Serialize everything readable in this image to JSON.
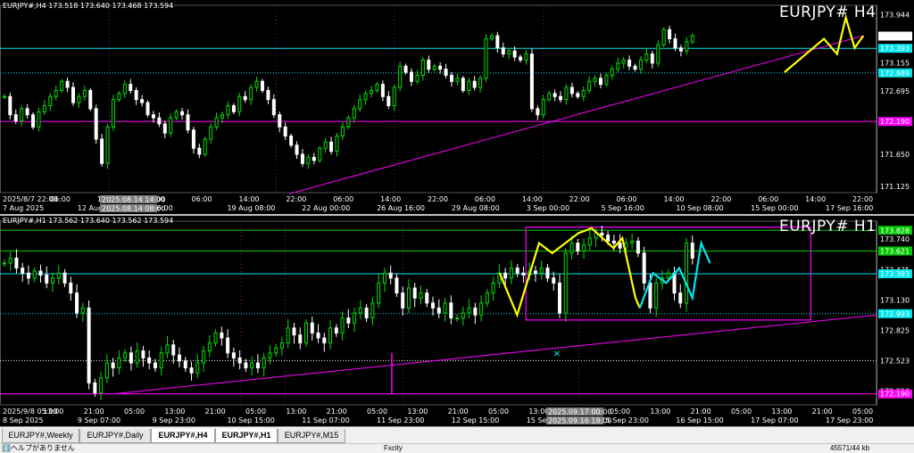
{
  "colors": {
    "bull": "#00e000",
    "bear": "#ffffff",
    "cyan": "#00e5ee",
    "magenta": "#ff00ff",
    "yellow": "#ffff00",
    "grid": "#2a2a2a",
    "axis": "#ffffff"
  },
  "tabs": [
    {
      "label": "EURJPY#,Weekly",
      "active": false
    },
    {
      "label": "EURJPY#,Daily",
      "active": false
    },
    {
      "label": "EURJPY#,H4",
      "active": false
    },
    {
      "label": "EURJPY#,H1",
      "active": true
    },
    {
      "label": "EURJPY#,M15",
      "active": false
    }
  ],
  "status": {
    "left": "ℹ️ヘルプがありません",
    "center": "Fxcity",
    "right": "45571/44 kb"
  },
  "chart_data": [
    {
      "type": "candlestick",
      "title": "EURJPY# H4",
      "header": "EURJPY#,H4  173.518 173.640 173.468 173.594",
      "ylim": [
        171.02,
        174.1
      ],
      "yticks": [
        173.944,
        173.594,
        173.393,
        173.155,
        172.989,
        172.695,
        172.19,
        171.65,
        171.125
      ],
      "price_labels": [
        {
          "value": 173.944,
          "text": "173.944",
          "bg": "#000",
          "fg": "#fff"
        },
        {
          "value": 173.594,
          "text": "173.594",
          "bg": "#ffffff",
          "fg": "#000"
        },
        {
          "value": 173.393,
          "text": "173.393",
          "bg": "#00e5ee",
          "fg": "#000"
        },
        {
          "value": 173.155,
          "text": "173.155",
          "bg": "#000",
          "fg": "#fff"
        },
        {
          "value": 172.989,
          "text": "172.989",
          "bg": "#00e5ee",
          "fg": "#000"
        },
        {
          "value": 172.695,
          "text": "172.695",
          "bg": "#000",
          "fg": "#fff"
        },
        {
          "value": 172.19,
          "text": "172.190",
          "bg": "#ff00ff",
          "fg": "#000"
        },
        {
          "value": 171.65,
          "text": "171.650",
          "bg": "#000",
          "fg": "#fff"
        },
        {
          "value": 171.125,
          "text": "171.125",
          "bg": "#000",
          "fg": "#fff"
        }
      ],
      "xlabels": [
        "2025/8/7 22:00",
        "06:00",
        "14:00",
        "22:00",
        "06:00",
        "14:00",
        "22:00",
        "06:00",
        "14:00",
        "22:00",
        "06:00",
        "14:00",
        "22:00",
        "06:00",
        "14:00",
        "22:00",
        "06:00",
        "14:00",
        "22:00"
      ],
      "xlabels2": [
        "7 Aug 2025",
        "12 Aug",
        "16:00",
        "19 Aug 08:00",
        "22 Aug 00:00",
        "26 Aug 16:00",
        "29 Aug 08:00",
        "3 Sep 00:00",
        "5 Sep 16:00",
        "10 Sep 08:00",
        "15 Sep 00:00",
        "17 Sep 16:00"
      ],
      "crosshair_labels": [
        "2025.08.14 14:00",
        "2025.08.14 08:00"
      ],
      "hlines": [
        {
          "value": 173.393,
          "color": "#00e5ee",
          "style": "solid"
        },
        {
          "value": 172.989,
          "color": "#00e5ee",
          "style": "dotted"
        },
        {
          "value": 172.19,
          "color": "#ff00ff",
          "style": "solid"
        }
      ],
      "trendline": {
        "from": [
          0.33,
          171.0
        ],
        "to": [
          0.985,
          173.6
        ],
        "color": "#ff00ff"
      },
      "close_path": [
        172.6,
        172.3,
        172.2,
        172.4,
        172.3,
        172.1,
        172.35,
        172.45,
        172.6,
        172.7,
        172.85,
        172.75,
        172.5,
        172.6,
        172.7,
        172.4,
        171.9,
        171.5,
        172.1,
        172.55,
        172.65,
        172.8,
        172.7,
        172.55,
        172.5,
        172.3,
        172.25,
        172.15,
        172.0,
        172.25,
        172.35,
        172.3,
        172.05,
        171.75,
        171.65,
        171.9,
        172.1,
        172.25,
        172.3,
        172.45,
        172.35,
        172.6,
        172.55,
        172.75,
        172.85,
        172.7,
        172.55,
        172.3,
        172.1,
        171.95,
        171.8,
        171.65,
        171.5,
        171.6,
        171.55,
        171.75,
        171.85,
        171.7,
        171.95,
        172.1,
        172.25,
        172.4,
        172.55,
        172.65,
        172.7,
        172.8,
        172.6,
        172.45,
        172.75,
        173.1,
        173.0,
        172.85,
        172.95,
        173.2,
        173.05,
        173.1,
        173.05,
        172.95,
        172.85,
        172.9,
        172.7,
        172.85,
        172.75,
        172.9,
        173.55,
        173.6,
        173.4,
        173.3,
        173.35,
        173.25,
        173.2,
        173.3,
        172.4,
        172.3,
        172.55,
        172.65,
        172.6,
        172.55,
        172.75,
        172.65,
        172.6,
        172.7,
        172.85,
        172.9,
        172.8,
        172.95,
        173.05,
        173.15,
        173.2,
        173.1,
        173.05,
        173.2,
        173.3,
        173.15,
        173.45,
        173.7,
        173.55,
        173.4,
        173.35,
        173.5,
        173.6
      ],
      "zigzag": [
        [
          0.895,
          173.0
        ],
        [
          0.94,
          173.55
        ],
        [
          0.955,
          173.3
        ],
        [
          0.965,
          173.9
        ],
        [
          0.975,
          173.4
        ],
        [
          0.985,
          173.6
        ]
      ]
    },
    {
      "type": "candlestick",
      "title": "EURJPY# H1",
      "header": "EURJPY#,H1  173.562 173.640 173.562 173.594",
      "ylim": [
        172.08,
        173.92
      ],
      "yticks": [
        173.828,
        173.74,
        173.621,
        173.435,
        173.393,
        173.13,
        172.993,
        172.825,
        172.523,
        172.22,
        172.19
      ],
      "price_labels": [
        {
          "value": 173.828,
          "text": "173.828",
          "bg": "#00c800",
          "fg": "#000"
        },
        {
          "value": 173.74,
          "text": "173.740",
          "bg": "#000",
          "fg": "#fff"
        },
        {
          "value": 173.621,
          "text": "173.621",
          "bg": "#00c800",
          "fg": "#000"
        },
        {
          "value": 173.435,
          "text": "173.435",
          "bg": "#000",
          "fg": "#fff"
        },
        {
          "value": 173.393,
          "text": "173.393",
          "bg": "#00e5ee",
          "fg": "#000"
        },
        {
          "value": 173.13,
          "text": "173.130",
          "bg": "#000",
          "fg": "#fff"
        },
        {
          "value": 172.993,
          "text": "172.993",
          "bg": "#00e5ee",
          "fg": "#000"
        },
        {
          "value": 172.825,
          "text": "172.825",
          "bg": "#000",
          "fg": "#fff"
        },
        {
          "value": 172.523,
          "text": "172.523",
          "bg": "#000",
          "fg": "#fff"
        },
        {
          "value": 172.22,
          "text": "172.220",
          "bg": "#000",
          "fg": "#fff"
        },
        {
          "value": 172.19,
          "text": "172.190",
          "bg": "#ff00ff",
          "fg": "#000"
        }
      ],
      "xlabels": [
        "2025/9/8 05:00",
        "13:00",
        "21:00",
        "05:00",
        "13:00",
        "21:00",
        "05:00",
        "13:00",
        "21:00",
        "05:00",
        "13:00",
        "21:00",
        "05:00",
        "13:00",
        "21:00",
        "05:00",
        "13:00",
        "21:00",
        "05:00",
        "13:00",
        "21:00",
        "05:00"
      ],
      "xlabels2": [
        "8 Sep 2025",
        "9 Sep 07:00",
        "9 Sep 23:00",
        "10 Sep 15:00",
        "11 Sep 07:00",
        "11 Sep 23:00",
        "12 Sep 15:00",
        "15 Sep 07:00",
        "15 Sep 23:00",
        "16 Sep 15:00",
        "17 Sep 07:00",
        "17 Sep 23:00"
      ],
      "crosshair_labels": [
        "2025.09.17 00:00",
        "2025.09.16 18:00"
      ],
      "hlines": [
        {
          "value": 173.828,
          "color": "#00c800",
          "style": "solid"
        },
        {
          "value": 173.621,
          "color": "#00c800",
          "style": "solid"
        },
        {
          "value": 173.393,
          "color": "#00e5ee",
          "style": "solid"
        },
        {
          "value": 172.993,
          "color": "#00e5ee",
          "style": "dotted"
        },
        {
          "value": 172.523,
          "color": "#ffffff",
          "style": "dotted"
        },
        {
          "value": 172.19,
          "color": "#ff00ff",
          "style": "solid"
        }
      ],
      "rect": {
        "x0": 0.6,
        "x1": 0.925,
        "y0": 173.86,
        "y1": 172.93,
        "color": "#ff00ff"
      },
      "trendline": {
        "from": [
          0.13,
          172.19
        ],
        "to": [
          1.0,
          172.98
        ],
        "color": "#ff00ff"
      },
      "vmarker": {
        "x": 0.447,
        "from": 172.19,
        "to": 172.6,
        "color": "#ff00ff"
      },
      "close_path": [
        173.5,
        173.55,
        173.45,
        173.4,
        173.35,
        173.42,
        173.38,
        173.3,
        173.35,
        173.4,
        173.3,
        173.2,
        173.0,
        173.05,
        172.3,
        172.2,
        172.35,
        172.5,
        172.45,
        172.55,
        172.6,
        172.5,
        172.62,
        172.55,
        172.5,
        172.45,
        172.6,
        172.68,
        172.58,
        172.52,
        172.45,
        172.4,
        172.5,
        172.62,
        172.7,
        172.8,
        172.75,
        172.6,
        172.55,
        172.5,
        172.45,
        172.5,
        172.45,
        172.55,
        172.6,
        172.65,
        172.7,
        172.85,
        172.78,
        172.7,
        172.9,
        172.8,
        172.75,
        172.7,
        172.85,
        172.8,
        172.95,
        172.9,
        173.0,
        173.05,
        172.95,
        173.1,
        173.3,
        173.4,
        173.35,
        173.2,
        173.05,
        173.25,
        173.15,
        173.2,
        173.1,
        173.05,
        173.0,
        173.1,
        172.95,
        172.95,
        173.0,
        173.05,
        172.98,
        173.1,
        173.2,
        173.3,
        173.4,
        173.35,
        173.45,
        173.4,
        173.38,
        173.42,
        173.4,
        173.45,
        173.35,
        173.3,
        173.0,
        173.6,
        173.7,
        173.62,
        173.68,
        173.75,
        173.8,
        173.78,
        173.72,
        173.7,
        173.65,
        173.7,
        173.72,
        173.6,
        173.3,
        173.05,
        173.3,
        173.35,
        173.4,
        173.2,
        173.1,
        173.7,
        173.55
      ],
      "zigzag_yellow": [
        [
          0.57,
          173.4
        ],
        [
          0.59,
          172.98
        ],
        [
          0.615,
          173.7
        ],
        [
          0.63,
          173.6
        ],
        [
          0.66,
          173.8
        ],
        [
          0.675,
          173.85
        ],
        [
          0.7,
          173.65
        ],
        [
          0.71,
          173.75
        ],
        [
          0.725,
          173.15
        ],
        [
          0.73,
          173.05
        ]
      ],
      "zigzag_cyan": [
        [
          0.73,
          173.05
        ],
        [
          0.745,
          173.4
        ],
        [
          0.76,
          173.3
        ],
        [
          0.775,
          173.45
        ],
        [
          0.79,
          173.15
        ],
        [
          0.8,
          173.7
        ],
        [
          0.81,
          173.5
        ]
      ],
      "marker": {
        "x": 0.635,
        "value": 172.6,
        "glyph": "✕",
        "color": "#00e5ee"
      }
    }
  ]
}
